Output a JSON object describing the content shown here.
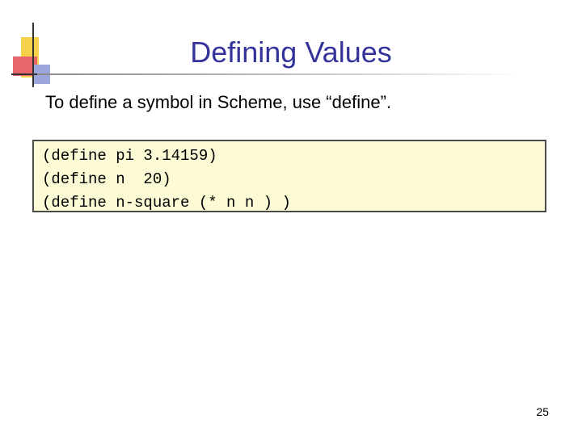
{
  "slide": {
    "title": "Defining Values",
    "intro": "To define a symbol in Scheme, use “define”.",
    "code_lines": [
      "(define pi 3.14159)",
      "(define n  20)",
      "(define n-square (* n n ) )"
    ],
    "page_number": "25"
  },
  "colors": {
    "title": "#33339a",
    "code_background": "#fdfbd6",
    "code_border": "#4a4a4a",
    "deco_yellow": "#f6d24a",
    "deco_red": "#e8656b",
    "deco_blue": "#9aa6dc"
  }
}
